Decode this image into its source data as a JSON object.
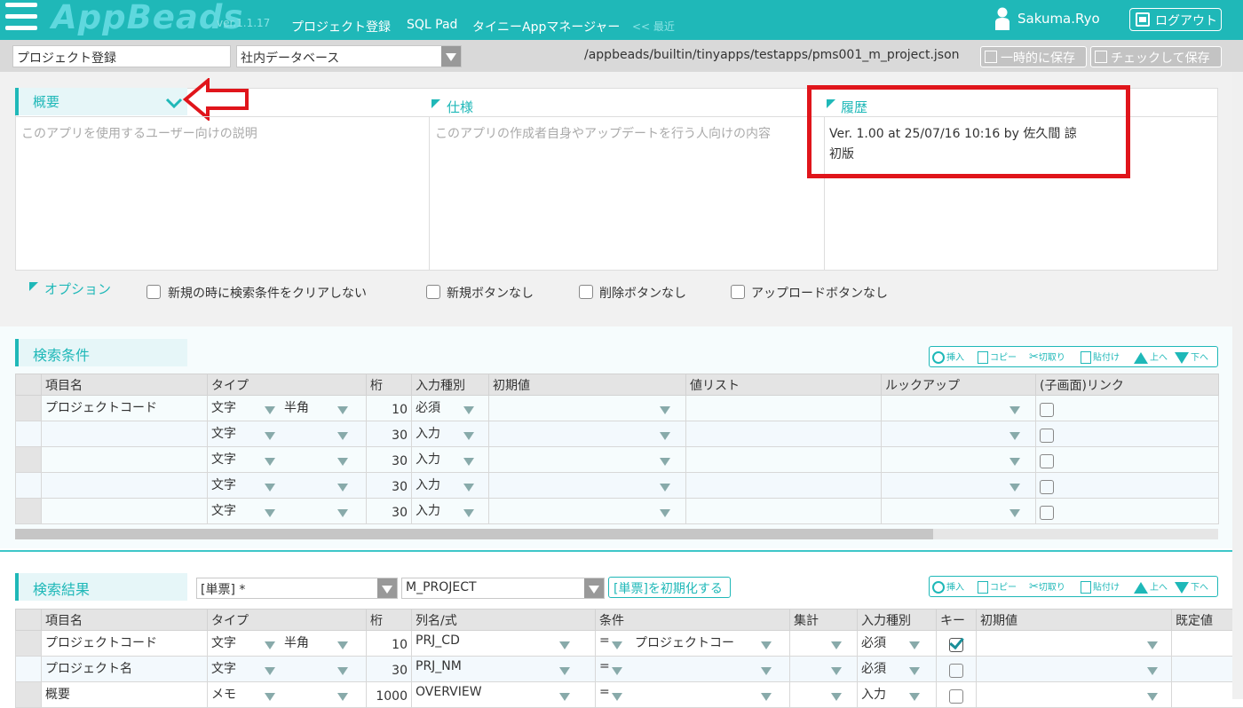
{
  "header": {
    "logo": "AppBeads",
    "version": "ver.1.1.17",
    "nav": [
      "プロジェクト登録",
      "SQL Pad",
      "タイニーAppマネージャー"
    ],
    "recent": "<< 最近",
    "user": "Sakuma.Ryo",
    "logout": "ログアウト"
  },
  "toolbar": {
    "project_name": "プロジェクト登録",
    "db": "社内データベース",
    "path": "/appbeads/builtin/tinyapps/testapps/pms001_m_project.json",
    "save_temp": "一時的に保存",
    "save_check": "チェックして保存"
  },
  "overview": {
    "title": "概要",
    "desc_placeholder": "このアプリを使用するユーザー向けの説明",
    "spec_title": "仕様",
    "spec_placeholder": "このアプリの作成者自身やアップデートを行う人向けの内容",
    "history_title": "履歴",
    "history_line1": "Ver. 1.00    at 25/07/16 10:16    by 佐久間 諒",
    "history_line2": "初版"
  },
  "options": {
    "title": "オプション",
    "items": [
      "新規の時に検索条件をクリアしない",
      "新規ボタンなし",
      "削除ボタンなし",
      "アップロードボタンなし"
    ]
  },
  "grid_buttons": [
    "挿入",
    "コピー",
    "切取り",
    "貼付け",
    "上へ",
    "下へ"
  ],
  "search_cond": {
    "title": "検索条件",
    "headers": [
      "項目名",
      "タイプ",
      "桁",
      "入力種別",
      "初期値",
      "値リスト",
      "ルックアップ",
      "(子画面)リンク"
    ],
    "rows": [
      {
        "name": "プロジェクトコード",
        "type": "文字",
        "sub": "半角",
        "digits": "10",
        "input": "必須"
      },
      {
        "name": "",
        "type": "文字",
        "sub": "",
        "digits": "30",
        "input": "入力"
      },
      {
        "name": "",
        "type": "文字",
        "sub": "",
        "digits": "30",
        "input": "入力"
      },
      {
        "name": "",
        "type": "文字",
        "sub": "",
        "digits": "30",
        "input": "入力"
      },
      {
        "name": "",
        "type": "文字",
        "sub": "",
        "digits": "30",
        "input": "入力"
      }
    ]
  },
  "search_result": {
    "title": "検索結果",
    "mode": "[単票] *",
    "table": "M_PROJECT",
    "init_button": "[単票]を初期化する",
    "headers": [
      "項目名",
      "タイプ",
      "桁",
      "列名/式",
      "条件",
      "集計",
      "入力種別",
      "キー",
      "初期値",
      "既定値"
    ],
    "rows": [
      {
        "name": "プロジェクトコード",
        "type": "文字",
        "sub": "半角",
        "digits": "10",
        "col": "PRJ_CD",
        "cond": "=",
        "cond_val": "プロジェクトコー",
        "input": "必須",
        "key": true
      },
      {
        "name": "プロジェクト名",
        "type": "文字",
        "sub": "",
        "digits": "30",
        "col": "PRJ_NM",
        "cond": "=",
        "cond_val": "",
        "input": "必須",
        "key": false
      },
      {
        "name": "概要",
        "type": "メモ",
        "sub": "",
        "digits": "1000",
        "col": "OVERVIEW",
        "cond": "=",
        "cond_val": "",
        "input": "入力",
        "key": false
      }
    ]
  }
}
